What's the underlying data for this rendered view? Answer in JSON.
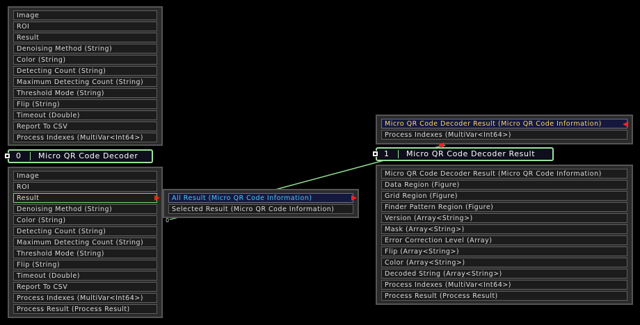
{
  "colors": {
    "link": "#8cdc8c",
    "arrow": "#ff2020",
    "node_border": "#9be39b",
    "selected_text": "#ffd76b",
    "selected_text_blue": "#4fc7ff"
  },
  "top_input_panel": {
    "rows": [
      "Image",
      "ROI",
      "Result",
      "Denoising Method (String)",
      "Color (String)",
      "Detecting Count (String)",
      "Maximum Detecting Count (String)",
      "Threshold Mode (String)",
      "Flip (String)",
      "Timeout (Double)",
      "Report To CSV",
      "Process Indexes (MultiVar<Int64>)"
    ]
  },
  "node_decoder": {
    "index": "0",
    "title": "Micro QR Code Decoder",
    "pin_icon": "port-icon"
  },
  "decoder_output_panel": {
    "rows": [
      "Image",
      "ROI",
      "Result",
      "Denoising Method (String)",
      "Color (String)",
      "Detecting Count (String)",
      "Maximum Detecting Count (String)",
      "Threshold Mode (String)",
      "Flip (String)",
      "Timeout (Double)",
      "Report To CSV",
      "Process Indexes (MultiVar<Int64>)",
      "Process Result (Process Result)"
    ]
  },
  "result_selector": {
    "rows": [
      "All Result (Micro QR Code Information)",
      "Selected Result (Micro QR Code Information)"
    ],
    "zero_label": "0"
  },
  "result_input_panel": {
    "rows": [
      "Micro QR Code Decoder Result (Micro QR Code Information)",
      "Process Indexes (MultiVar<Int64>)"
    ]
  },
  "node_result": {
    "index": "1",
    "title": "Micro QR Code Decoder Result",
    "pin_icon": "port-icon"
  },
  "result_output_panel": {
    "rows": [
      "Micro QR Code Decoder Result (Micro QR Code Information)",
      "Data Region (Figure)",
      "Grid Region (Figure)",
      "Finder Pattern Region (Figure)",
      "Version (Array<String>)",
      "Mask (Array<String>)",
      "Error Correction Level (Array)",
      "Flip (Array<String>)",
      "Color (Array<String>)",
      "Decoded String (Array<String>)",
      "Process Indexes (MultiVar<Int64>)",
      "Process Result (Process Result)"
    ]
  }
}
